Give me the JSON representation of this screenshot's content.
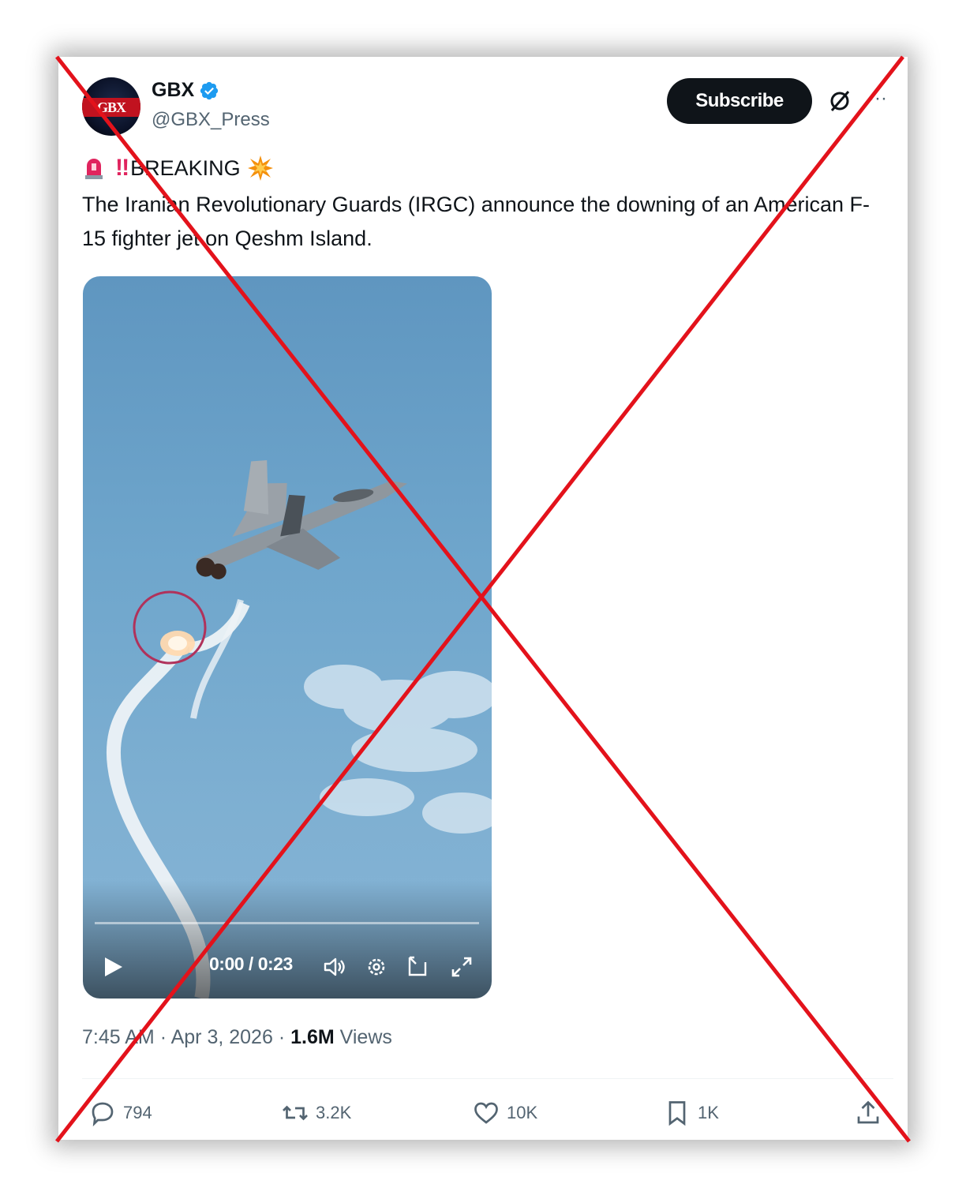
{
  "author": {
    "name": "GBX",
    "handle": "@GBX_Press",
    "avatar_text": "GBX"
  },
  "header": {
    "subscribe_label": "Subscribe"
  },
  "post": {
    "headline": "BREAKING",
    "headline_marks": "‼",
    "text": "The Iranian Revolutionary Guards (IRGC) announce the downing of an American F-15 fighter jet on Qeshm Island."
  },
  "video": {
    "time": "0:00 / 0:23",
    "progress": 0
  },
  "meta": {
    "time": "7:45 AM",
    "sep1": "·",
    "date": "Apr 3, 2026",
    "sep2": "·",
    "views_count": "1.6M",
    "views_label": "Views"
  },
  "actions": {
    "replies": "794",
    "reposts": "3.2K",
    "likes": "10K",
    "bookmarks": "1K"
  },
  "colors": {
    "overlay_cross": "#e3121b",
    "verified": "#1d9bf0",
    "text_secondary": "#536471"
  },
  "icons": [
    "verified-icon",
    "grok-icon",
    "more-icon",
    "siren-icon",
    "collision-icon",
    "play-icon",
    "volume-icon",
    "settings-icon",
    "pip-icon",
    "fullscreen-icon",
    "reply-icon",
    "repost-icon",
    "like-icon",
    "bookmark-icon",
    "share-icon"
  ]
}
